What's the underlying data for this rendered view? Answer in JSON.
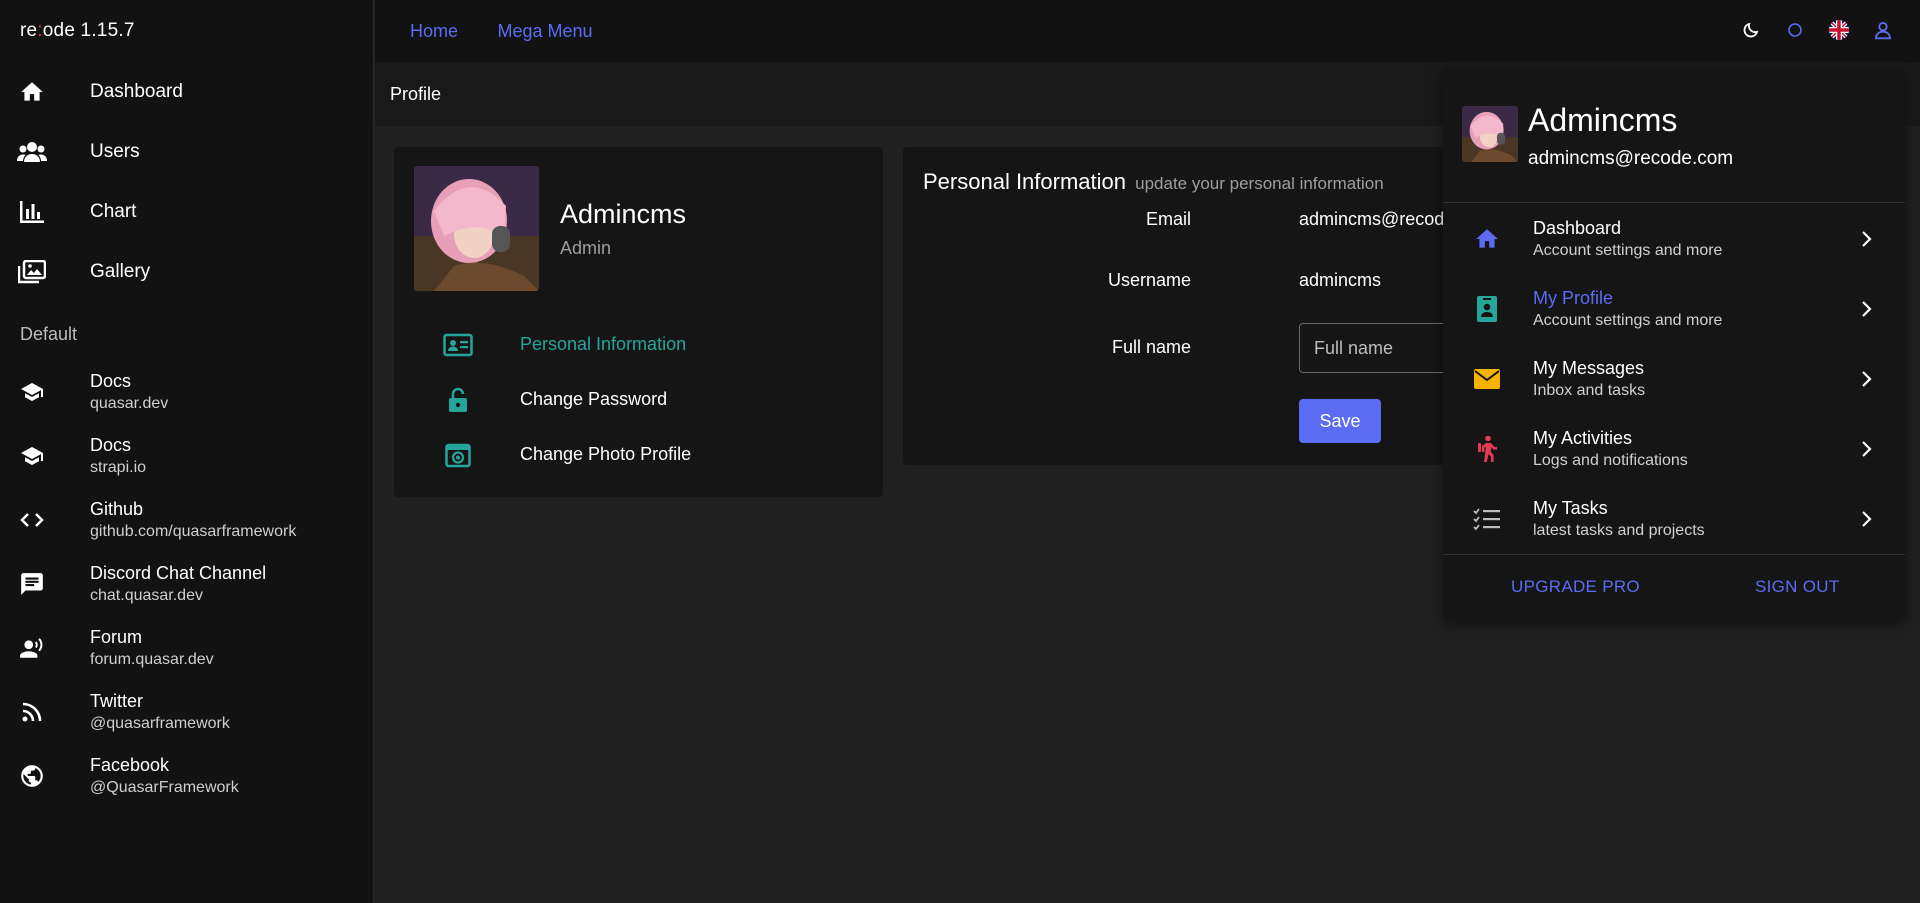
{
  "app": {
    "brand_prefix": "re",
    "brand_dot": ":",
    "brand_suffix": "ode 1.15.7"
  },
  "sidebar": {
    "nav": [
      {
        "label": "Dashboard",
        "icon": "home-icon"
      },
      {
        "label": "Users",
        "icon": "users-icon"
      },
      {
        "label": "Chart",
        "icon": "chart-icon"
      },
      {
        "label": "Gallery",
        "icon": "gallery-icon"
      }
    ],
    "section_label": "Default",
    "links": [
      {
        "title": "Docs",
        "subtitle": "quasar.dev",
        "icon": "school-icon"
      },
      {
        "title": "Docs",
        "subtitle": "strapi.io",
        "icon": "school-icon"
      },
      {
        "title": "Github",
        "subtitle": "github.com/quasarframework",
        "icon": "code-icon"
      },
      {
        "title": "Discord Chat Channel",
        "subtitle": "chat.quasar.dev",
        "icon": "chat-icon"
      },
      {
        "title": "Forum",
        "subtitle": "forum.quasar.dev",
        "icon": "record-voice-icon"
      },
      {
        "title": "Twitter",
        "subtitle": "@quasarframework",
        "icon": "rss-icon"
      },
      {
        "title": "Facebook",
        "subtitle": "@QuasarFramework",
        "icon": "public-icon"
      }
    ]
  },
  "topnav": {
    "home": "Home",
    "mega_menu": "Mega Menu"
  },
  "page": {
    "title": "Profile"
  },
  "profile_card": {
    "name": "Admincms",
    "role": "Admin",
    "menu": [
      {
        "label": "Personal Information",
        "icon": "id-card-icon",
        "active": true
      },
      {
        "label": "Change Password",
        "icon": "unlock-icon",
        "active": false
      },
      {
        "label": "Change Photo Profile",
        "icon": "camera-icon",
        "active": false
      }
    ]
  },
  "info_card": {
    "title": "Personal Information",
    "subtitle": "update your personal information",
    "email_label": "Email",
    "email_value": "admincms@recode.com",
    "username_label": "Username",
    "username_value": "admincms",
    "fullname_label": "Full name",
    "fullname_placeholder": "Full name",
    "save_label": "Save"
  },
  "dropdown": {
    "name": "Admincms",
    "email": "admincms@recode.com",
    "items": [
      {
        "title": "Dashboard",
        "subtitle": "Account settings and more",
        "icon": "home-icon",
        "color": "#5b6cf2"
      },
      {
        "title": "My Profile",
        "subtitle": "Account settings and more",
        "icon": "contact-badge-icon",
        "color": "#26a69a",
        "active": true
      },
      {
        "title": "My Messages",
        "subtitle": "Inbox and tasks",
        "icon": "mail-icon",
        "color": "#f5b300"
      },
      {
        "title": "My Activities",
        "subtitle": "Logs and notifications",
        "icon": "hiking-icon",
        "color": "#e53958"
      },
      {
        "title": "My Tasks",
        "subtitle": "latest tasks and projects",
        "icon": "checklist-icon",
        "color": "#9e9e9e"
      }
    ],
    "upgrade_label": "UPGRADE PRO",
    "signout_label": "SIGN OUT"
  },
  "colors": {
    "accent": "#5b6cf2",
    "teal": "#26a69a",
    "bg": "#202020",
    "panel": "#151515"
  }
}
